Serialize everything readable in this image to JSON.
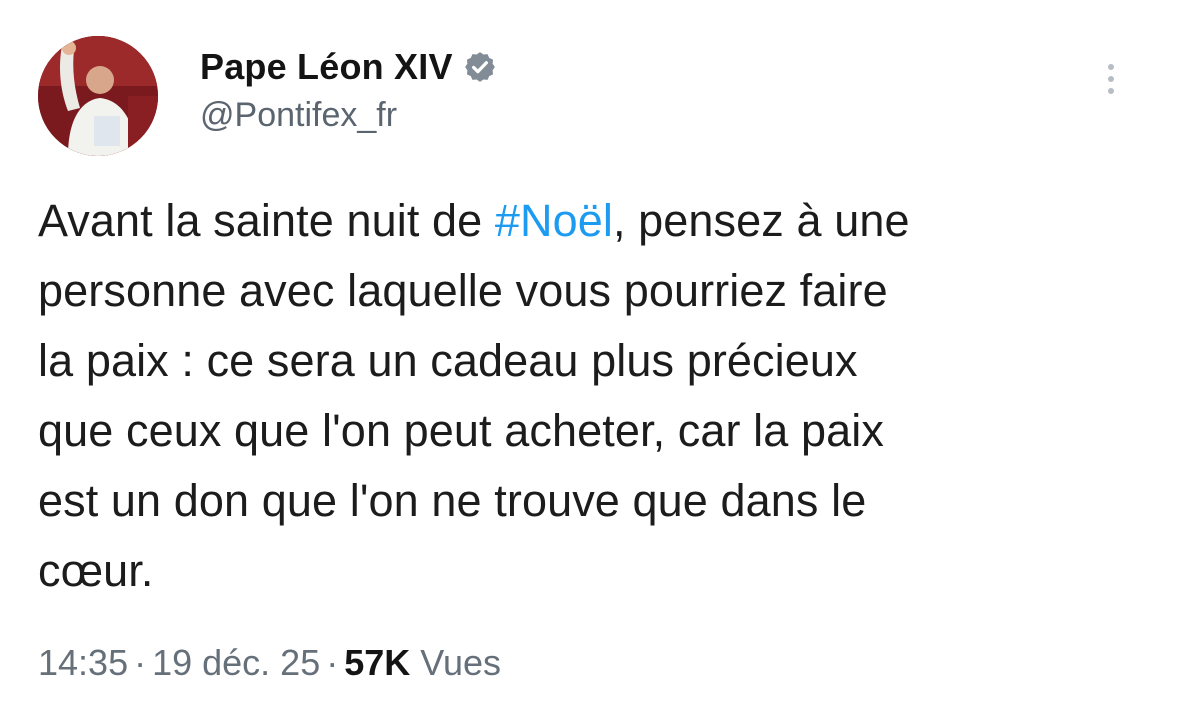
{
  "author": {
    "display_name": "Pape Léon XIV",
    "handle": "@Pontifex_fr",
    "verified_icon": "verified-badge-icon",
    "avatar_icon": "pope-avatar"
  },
  "more_icon": "more-vertical-icon",
  "text": {
    "line1_before": "Avant la sainte nuit de ",
    "hashtag": "#Noël",
    "line1_after": ", pensez à une",
    "line2": "personne avec laquelle vous pourriez faire",
    "line3": "la paix : ce sera un cadeau plus précieux",
    "line4": "que ceux que l'on peut acheter, car la paix",
    "line5": "est un don que l'on ne trouve que dans le",
    "line6": "cœur."
  },
  "meta": {
    "time": "14:35",
    "separator": "·",
    "date": "19 déc. 25",
    "views_count": "57K",
    "views_label": "Vues"
  },
  "colors": {
    "hashtag": "#1d9bf0",
    "verified_badge": "#828c96",
    "muted_text": "#66707a"
  }
}
